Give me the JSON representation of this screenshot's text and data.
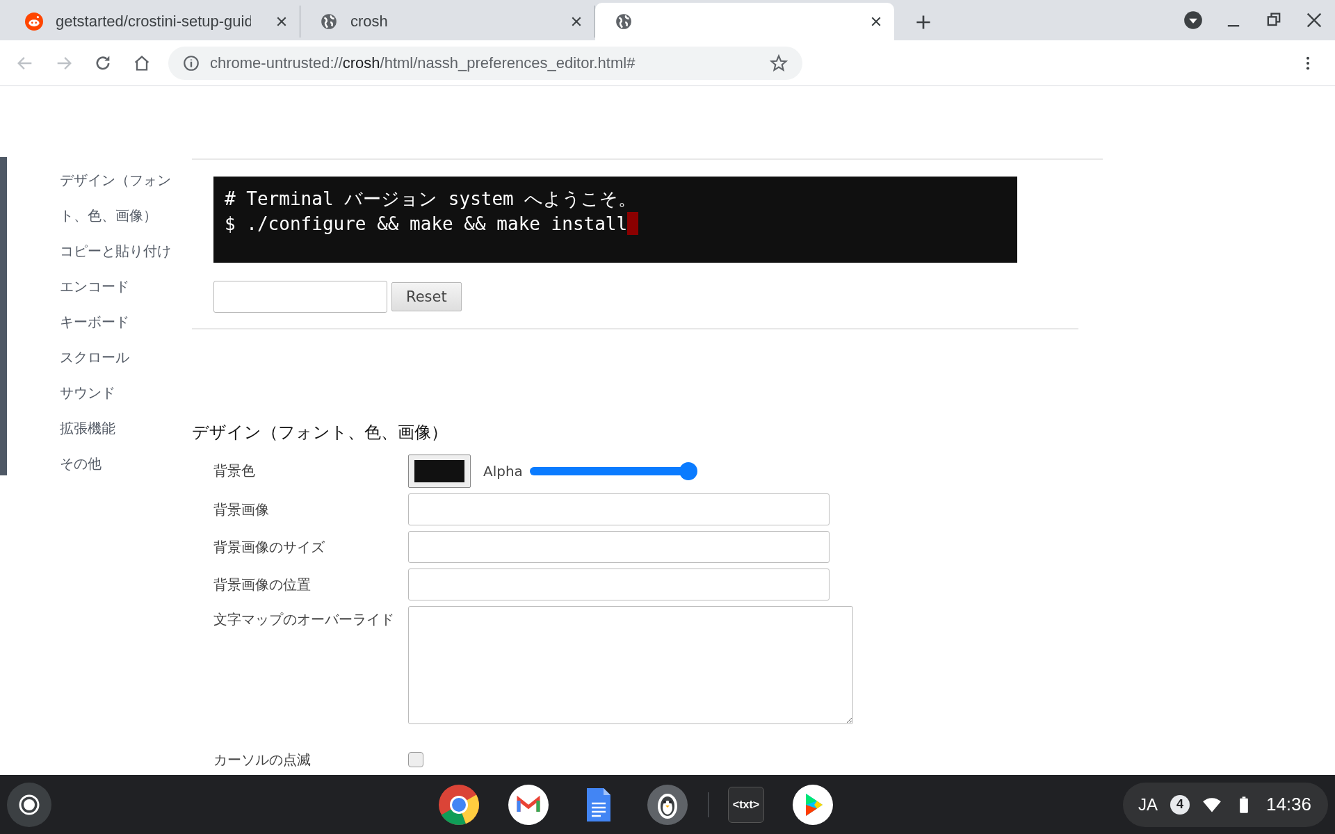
{
  "tabs": [
    {
      "title": "getstarted/crostini-setup-guid",
      "kind": "reddit",
      "selected": false
    },
    {
      "title": "crosh",
      "kind": "globe",
      "selected": false
    },
    {
      "kind": "globe",
      "selected": true
    }
  ],
  "address": {
    "scheme": "chrome-untrusted://",
    "host": "crosh",
    "path": "/html/nassh_preferences_editor.html#"
  },
  "sidebar": {
    "items": [
      "デザイン（フォント、色、画像）",
      "コピーと貼り付け",
      "エンコード",
      "キーボード",
      "スクロール",
      "サウンド",
      "拡張機能",
      "その他"
    ]
  },
  "preview": {
    "lines": [
      "# Terminal バージョン system へようこそ。",
      "$ ./configure && make && make install"
    ],
    "reset_button": "Reset"
  },
  "section": {
    "heading": "デザイン（フォント、色、画像）",
    "rows": [
      {
        "kind": "color",
        "label": "背景色",
        "alpha_label": "Alpha",
        "level": 1
      },
      {
        "kind": "text",
        "label": "背景画像"
      },
      {
        "kind": "text",
        "label": "背景画像のサイズ"
      },
      {
        "kind": "text",
        "label": "背景画像の位置"
      },
      {
        "kind": "textarea",
        "label": "文字マップのオーバーライド"
      },
      {
        "kind": "checkbox",
        "label": "カーソルの点滅",
        "checked": false
      }
    ]
  },
  "shelf": {
    "apps": [
      {
        "kind": "chrome"
      },
      {
        "kind": "mail"
      },
      {
        "kind": "docs"
      },
      {
        "kind": "penguin"
      },
      {
        "kind": "text",
        "label": "<txt>"
      },
      {
        "kind": "play"
      }
    ],
    "tray": {
      "ime": "JA",
      "badge": "4",
      "time": "14:36"
    }
  }
}
